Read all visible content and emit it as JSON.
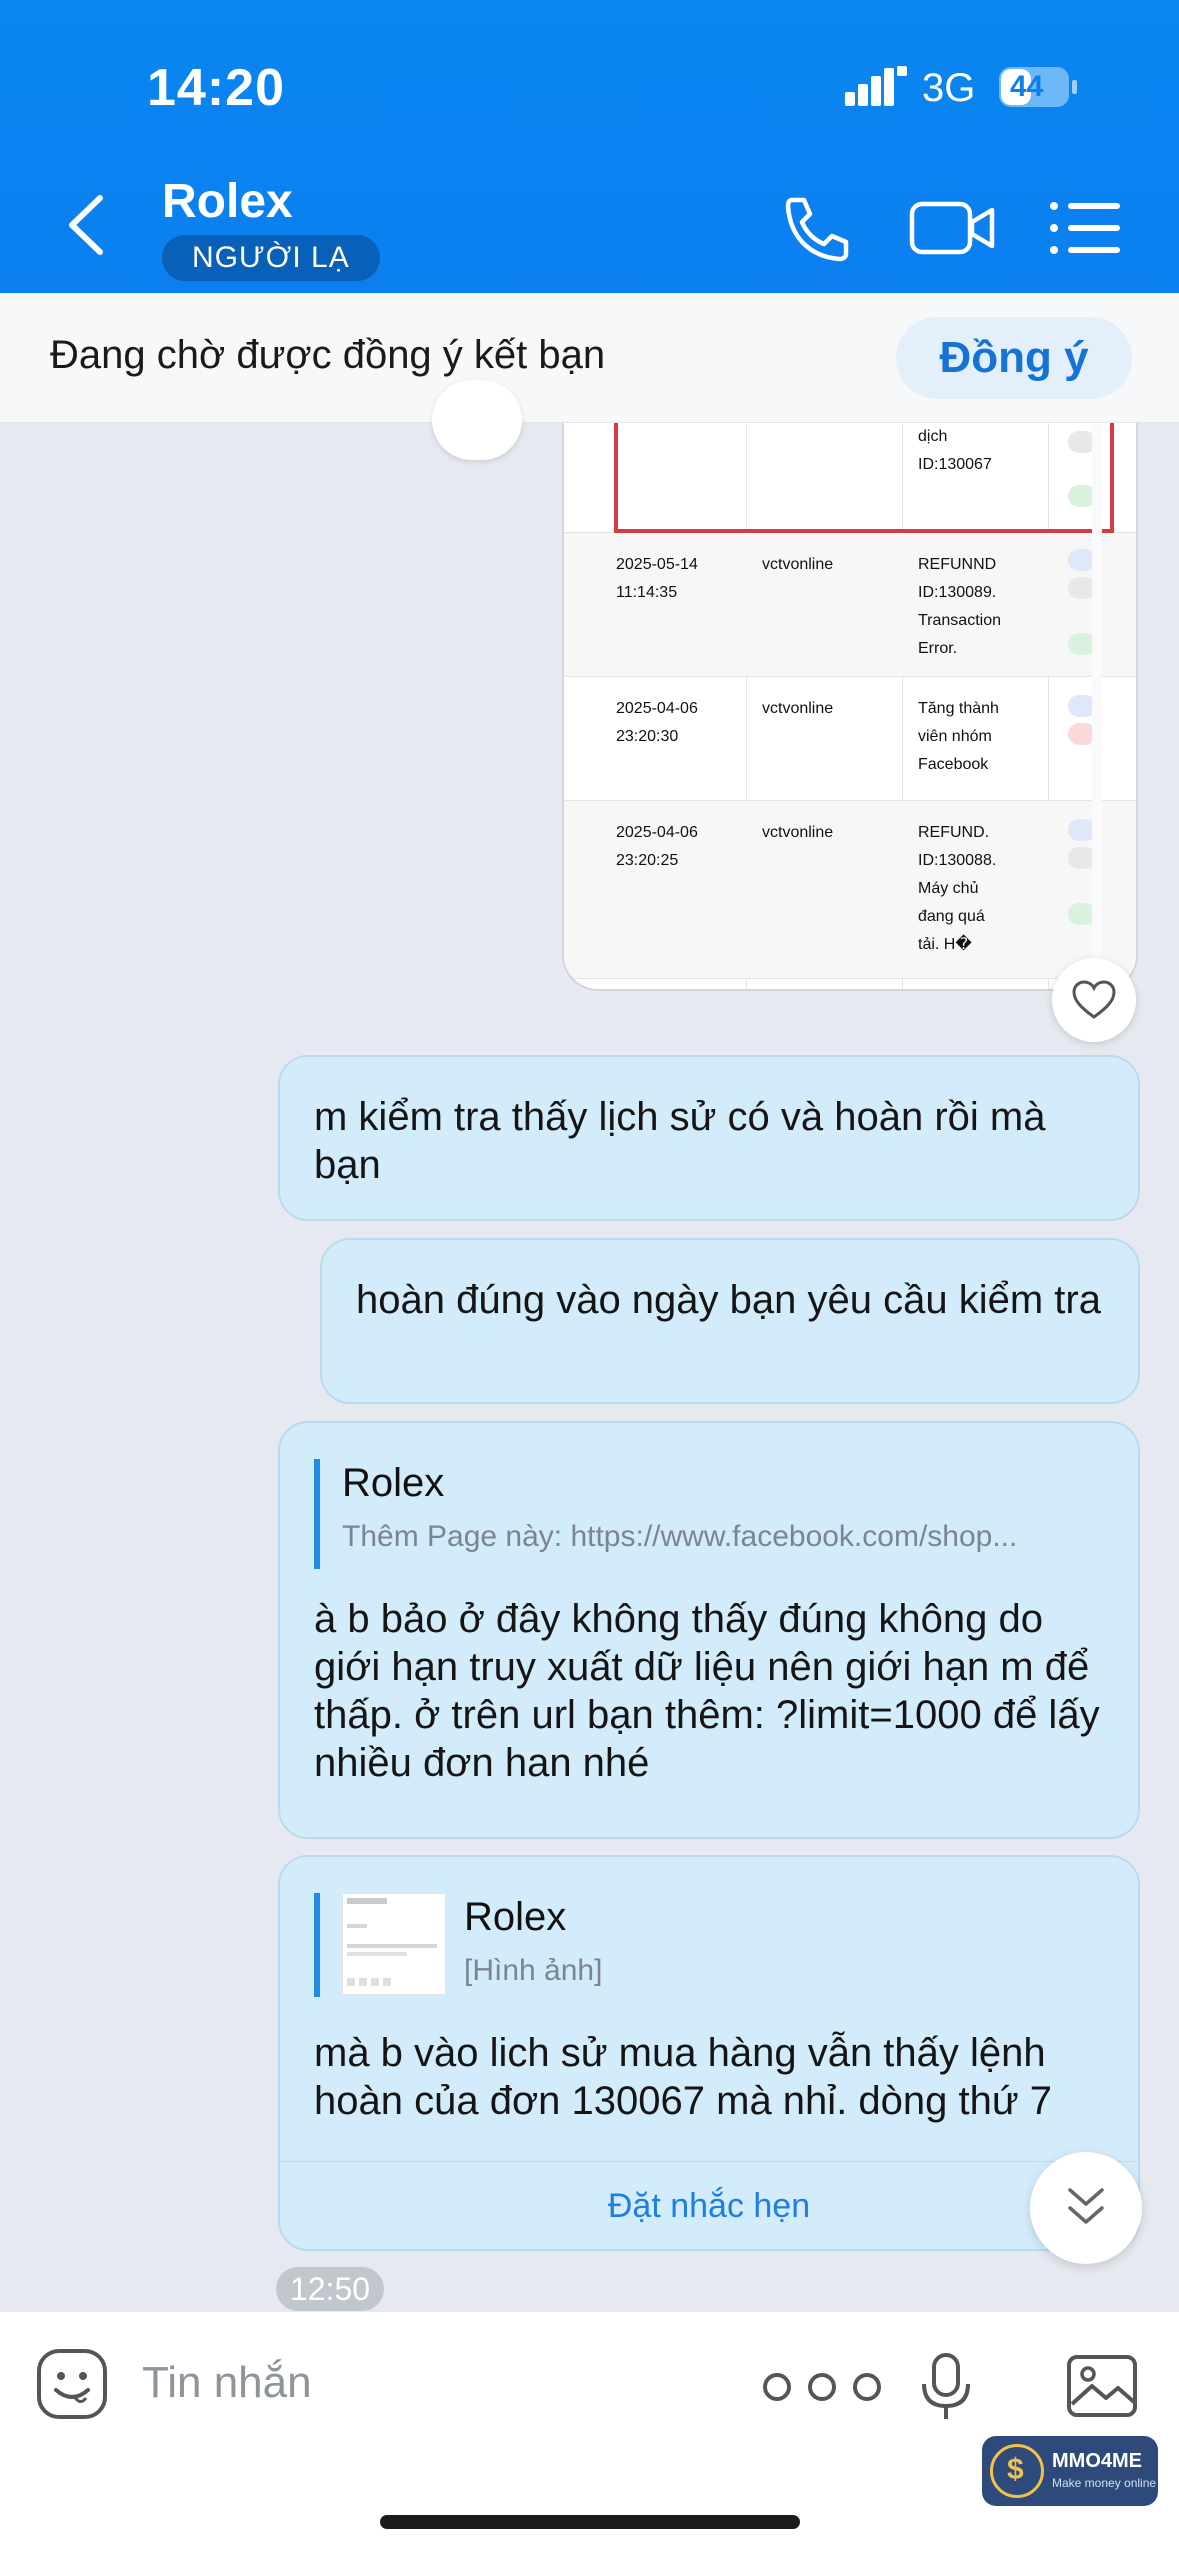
{
  "status_bar": {
    "time": "14:20",
    "network": "3G",
    "battery": "44"
  },
  "header": {
    "title": "Rolex",
    "badge": "NGƯỜI LẠ"
  },
  "pending_bar": {
    "text": "Đang chờ được đồng ý kết bạn",
    "accept_label": "Đồng ý"
  },
  "image_message": {
    "rows": [
      {
        "date": "",
        "user": "",
        "content": "dịch\nID:130067"
      },
      {
        "date": "2025-05-14\n11:14:35",
        "user": "vctvonline",
        "content": "REFUNND\nID:130089.\nTransaction\nError."
      },
      {
        "date": "2025-04-06\n23:20:30",
        "user": "vctvonline",
        "content": "Tăng thành\nviên nhóm\nFacebook"
      },
      {
        "date": "2025-04-06\n23:20:25",
        "user": "vctvonline",
        "content": "REFUND.\nID:130088.\nMáy chủ\nđang quá\ntải. H�"
      }
    ]
  },
  "messages": [
    {
      "text": "m kiểm tra thấy lịch sử có và hoàn rồi mà bạn"
    },
    {
      "text": "hoàn đúng vào ngày bạn yêu cầu kiểm tra"
    },
    {
      "quote_name": "Rolex",
      "quote_text": "Thêm Page này: https://www.facebook.com/shop...",
      "text": "à b bảo ở đây không thấy đúng không do giới hạn truy xuất dữ liệu nên giới hạn m để thấp. ở trên url bạn thêm: ?limit=1000 để lấy nhiều đơn han nhé"
    },
    {
      "quote_name": "Rolex",
      "quote_text": "[Hình ảnh]",
      "text": "mà b vào lich sử mua hàng vẫn thấy lệnh hoàn của đơn 130067 mà nhỉ. dòng thứ 7",
      "remind_label": "Đặt nhắc hẹn"
    }
  ],
  "time_chip": "12:50",
  "composer": {
    "placeholder": "Tin nhắn"
  },
  "watermark": {
    "name": "MMO4ME",
    "tagline": "Make money online"
  },
  "colors": {
    "header_blue": "#0b7ff0",
    "bubble_bg": "#d3ecfb",
    "accent": "#1f7fe0"
  }
}
